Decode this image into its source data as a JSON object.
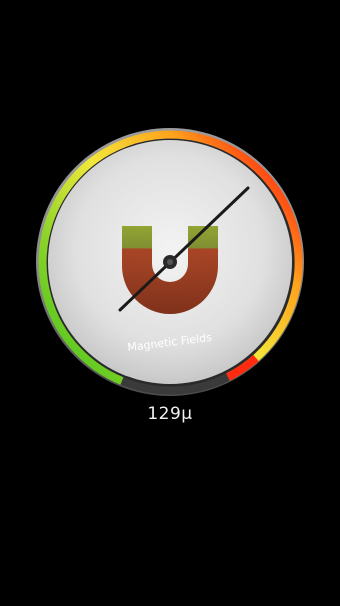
{
  "gauge": {
    "label": "Magnetic Fields",
    "reading": "129μ",
    "icon": "magnet-icon",
    "colors": {
      "low": "#49c81f",
      "mid": "#e6e030",
      "high": "#ff2a10",
      "face": "#e2e2e2",
      "needle": "#1a1a1a"
    }
  }
}
